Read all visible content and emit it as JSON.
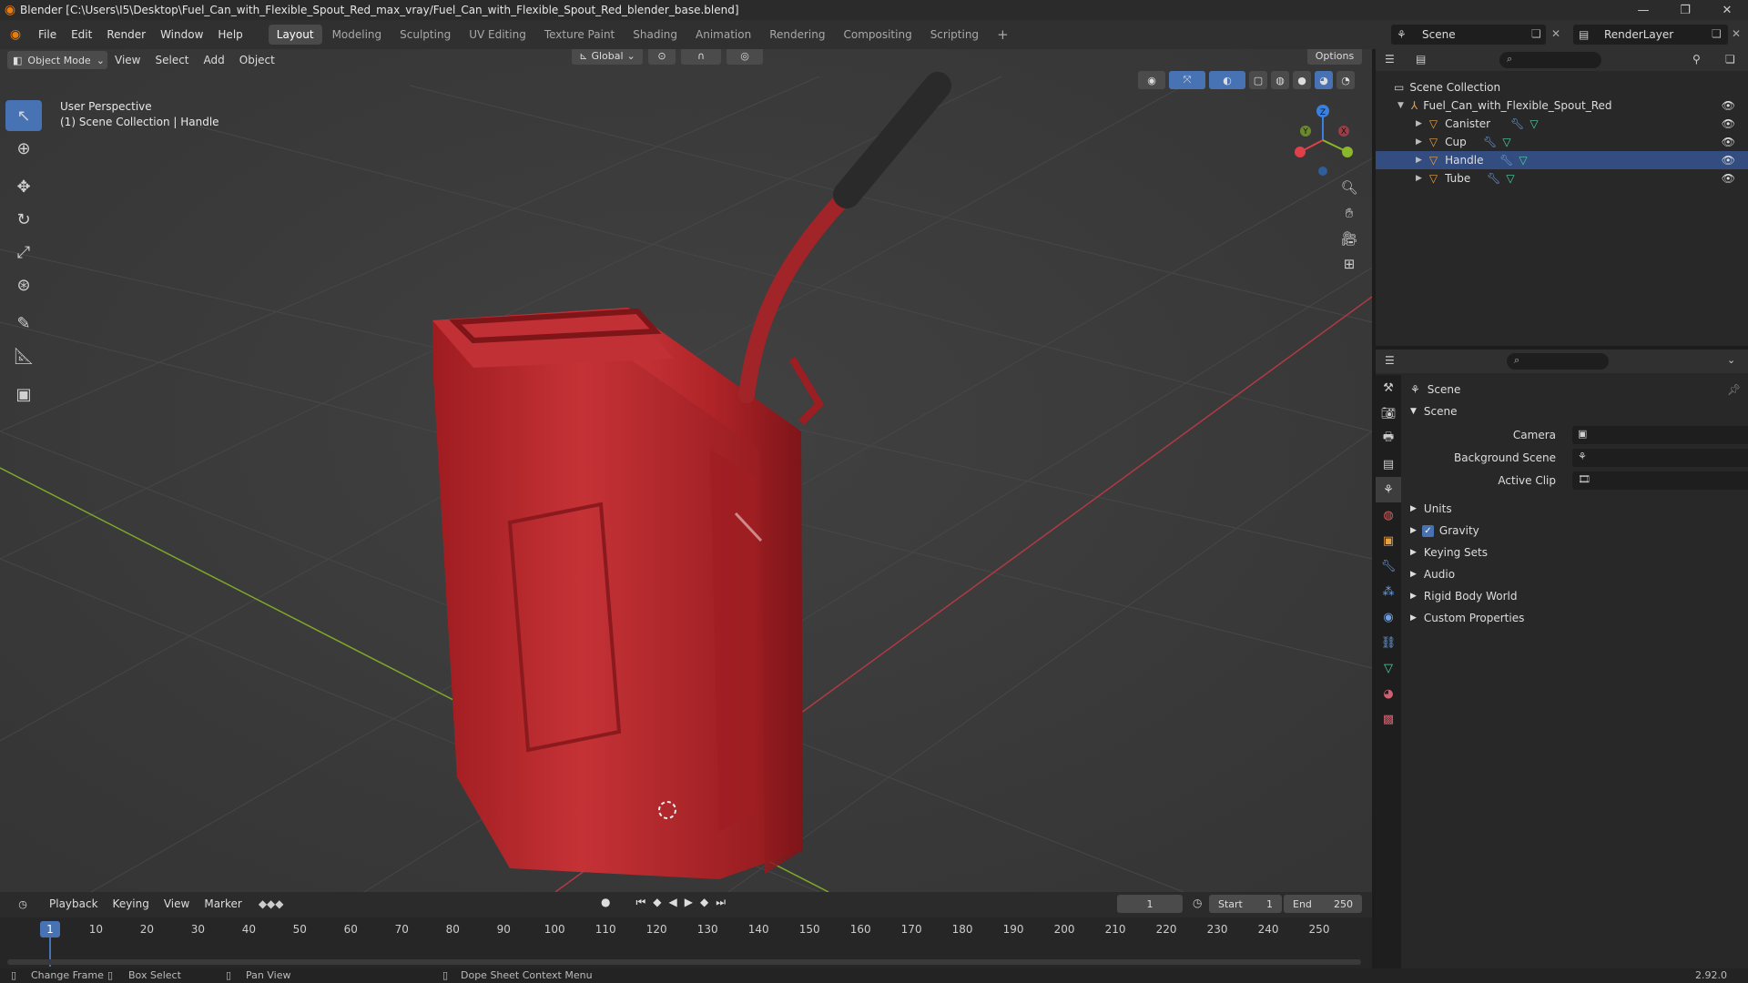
{
  "window": {
    "title": "Blender [C:\\Users\\I5\\Desktop\\Fuel_Can_with_Flexible_Spout_Red_max_vray/Fuel_Can_with_Flexible_Spout_Red_blender_base.blend]",
    "minimize": "—",
    "maximize": "❐",
    "close": "✕"
  },
  "menu": [
    "File",
    "Edit",
    "Render",
    "Window",
    "Help"
  ],
  "workspaces": [
    {
      "label": "Layout",
      "active": true
    },
    {
      "label": "Modeling"
    },
    {
      "label": "Sculpting"
    },
    {
      "label": "UV Editing"
    },
    {
      "label": "Texture Paint"
    },
    {
      "label": "Shading"
    },
    {
      "label": "Animation"
    },
    {
      "label": "Rendering"
    },
    {
      "label": "Compositing"
    },
    {
      "label": "Scripting"
    }
  ],
  "add_workspace": "+",
  "scene_name": "Scene",
  "render_layer": "RenderLayer",
  "viewport": {
    "mode": "Object Mode",
    "menus": [
      "View",
      "Select",
      "Add",
      "Object"
    ],
    "transform_orientation": "Global",
    "options": "Options",
    "info_line1": "User Perspective",
    "info_line2": "(1) Scene Collection | Handle",
    "gizmo": {
      "x": "X",
      "y": "Y",
      "z": "Z"
    }
  },
  "outliner": {
    "root": "Scene Collection",
    "collection": "Fuel_Can_with_Flexible_Spout_Red",
    "objects": [
      "Canister",
      "Cup",
      "Handle",
      "Tube"
    ]
  },
  "properties": {
    "header": "Scene",
    "panel": "Scene",
    "fields": [
      {
        "label": "Camera"
      },
      {
        "label": "Background Scene"
      },
      {
        "label": "Active Clip"
      }
    ],
    "subpanels": [
      {
        "label": "Units"
      },
      {
        "label": "Gravity",
        "checked": true
      },
      {
        "label": "Keying Sets"
      },
      {
        "label": "Audio"
      },
      {
        "label": "Rigid Body World"
      },
      {
        "label": "Custom Properties"
      }
    ]
  },
  "timeline": {
    "menus": [
      "Playback",
      "Keying",
      "View",
      "Marker"
    ],
    "current_frame": "1",
    "start_label": "Start",
    "start_value": "1",
    "end_label": "End",
    "end_value": "250",
    "ticks": [
      "1",
      "10",
      "20",
      "30",
      "40",
      "50",
      "60",
      "70",
      "80",
      "90",
      "100",
      "110",
      "120",
      "130",
      "140",
      "150",
      "160",
      "170",
      "180",
      "190",
      "200",
      "210",
      "220",
      "230",
      "240",
      "250"
    ]
  },
  "statusbar": {
    "change_frame": "Change Frame",
    "box_select": "Box Select",
    "pan_view": "Pan View",
    "context_menu": "Dope Sheet Context Menu",
    "version": "2.92.0"
  },
  "colors": {
    "accent": "#4772b3",
    "canister": "#b3262a",
    "axis_x": "#e0404a",
    "axis_y": "#8ab82a",
    "axis_z": "#3a80e0"
  }
}
